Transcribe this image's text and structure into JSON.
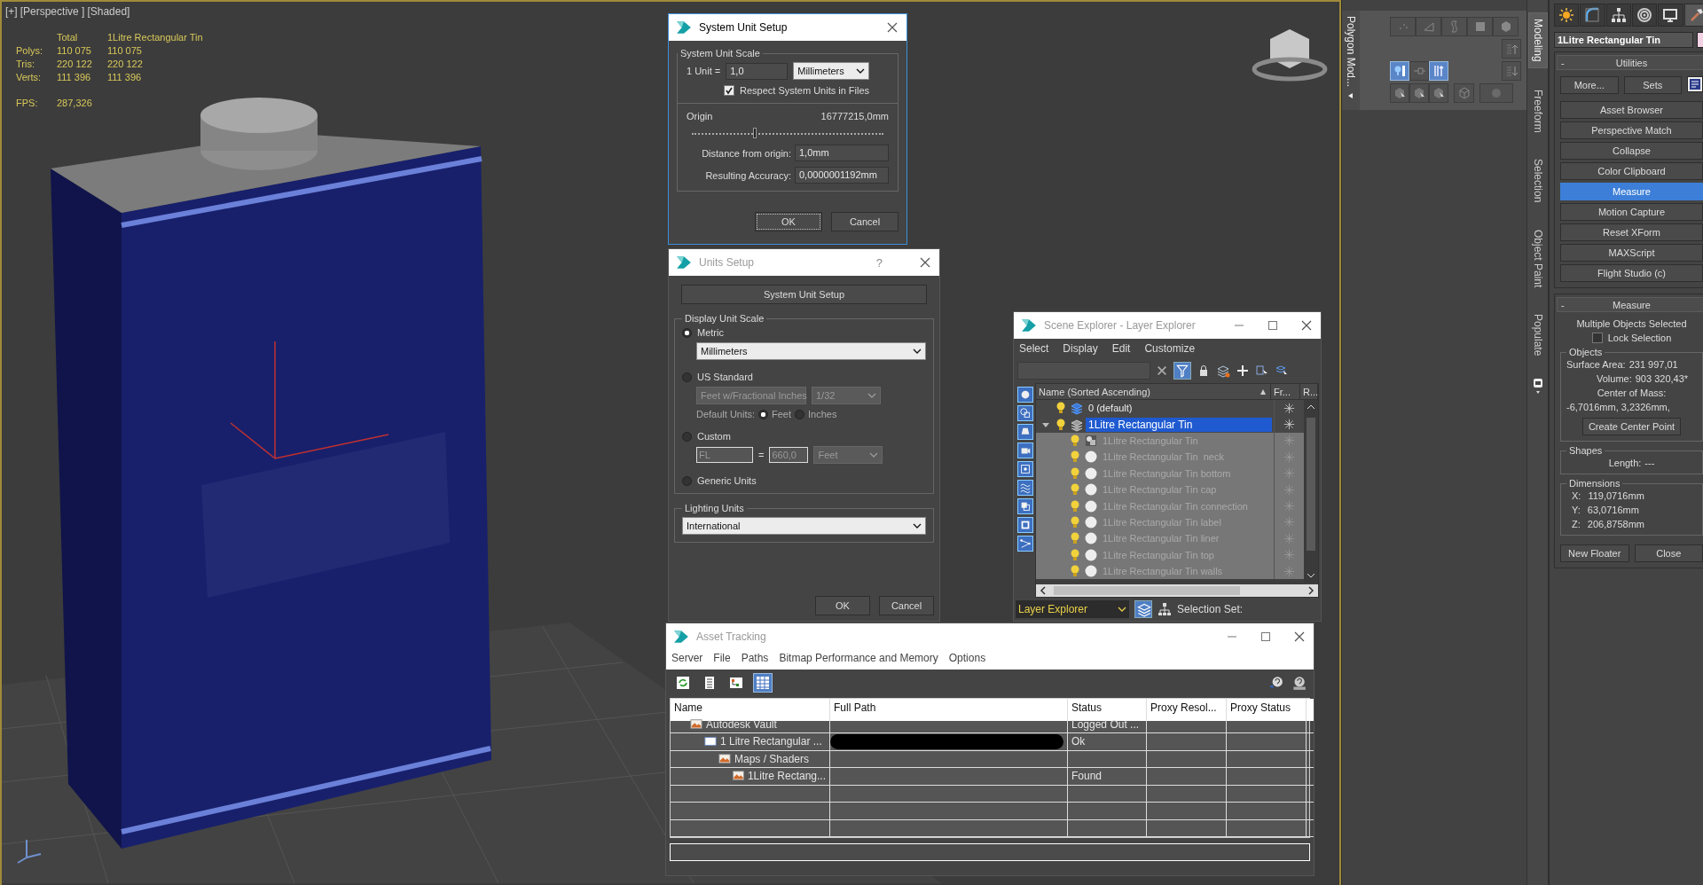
{
  "viewport": {
    "labels": [
      "[+]",
      "[Perspective ]",
      "[Shaded]"
    ],
    "stats": {
      "columns": [
        "Total",
        "1Litre Rectangular Tin"
      ],
      "rows": [
        {
          "label": "Polys:",
          "values": [
            "110 075",
            "110 075"
          ]
        },
        {
          "label": "Tris:",
          "values": [
            "220 122",
            "220 122"
          ]
        },
        {
          "label": "Verts:",
          "values": [
            "111 396",
            "111 396"
          ]
        }
      ],
      "fps_label": "FPS:",
      "fps": "287,326"
    }
  },
  "system_unit_setup": {
    "title": "System Unit Setup",
    "active": true,
    "group": "System Unit Scale",
    "unit_label": "1 Unit =",
    "unit_value": "1,0",
    "unit_dropdown": "Millimeters",
    "respect_checkbox": {
      "label": "Respect System Units in Files",
      "checked": true
    },
    "origin_label": "Origin",
    "origin_value": "16777215,0mm",
    "origin_slider": {
      "level": 0.33
    },
    "distance_label": "Distance from origin:",
    "distance_value": "1,0mm",
    "accuracy_label": "Resulting Accuracy:",
    "accuracy_value": "0,0000001192mm",
    "buttons": [
      "OK",
      "Cancel"
    ]
  },
  "units_setup": {
    "title": "Units Setup",
    "active": false,
    "help": "?",
    "system_button": "System Unit Setup",
    "display_group": "Display Unit Scale",
    "options": [
      {
        "kind": "metric",
        "label": "Metric",
        "selected": true,
        "dropdown": "Millimeters"
      },
      {
        "kind": "us",
        "label": "US Standard",
        "selected": false,
        "dropdowns": [
          "Feet w/Fractional Inches",
          "1/32"
        ],
        "default_units_label": "Default Units:",
        "default_units": [
          {
            "label": "Feet",
            "selected": true
          },
          {
            "label": "Inches",
            "selected": false
          }
        ]
      },
      {
        "kind": "custom",
        "label": "Custom",
        "selected": false,
        "name": "FL",
        "equals": "=",
        "value": "660,0",
        "unit": "Feet"
      },
      {
        "kind": "generic",
        "label": "Generic Units",
        "selected": false
      }
    ],
    "lighting_group": "Lighting Units",
    "lighting_dropdown": "International",
    "buttons": [
      "OK",
      "Cancel"
    ]
  },
  "scene_explorer": {
    "title": "Scene Explorer - Layer Explorer",
    "active": false,
    "menu": [
      "Select",
      "Display",
      "Edit",
      "Customize"
    ],
    "filters": [
      {
        "kind": "geometry",
        "on": true
      },
      {
        "kind": "shapes",
        "on": true
      },
      {
        "kind": "lights",
        "on": true
      },
      {
        "kind": "cameras",
        "on": true
      },
      {
        "kind": "helpers",
        "on": true
      },
      {
        "kind": "spacewarps",
        "on": true
      },
      {
        "kind": "groups",
        "on": true
      },
      {
        "kind": "xrefs",
        "on": true
      },
      {
        "kind": "bones",
        "on": true
      }
    ],
    "columns": [
      "Name (Sorted Ascending)",
      "Fr...",
      "R..."
    ],
    "layers": [
      {
        "name": "0 (default)",
        "selected": false,
        "current": true
      },
      {
        "name": "1Litre Rectangular Tin",
        "selected": true,
        "current": false,
        "expanded": true,
        "children": [
          {
            "name": "1Litre Rectangular Tin",
            "kind": "group",
            "selected": false
          },
          {
            "name": "1Litre Rectangular Tin  neck",
            "kind": "object",
            "selected": false
          },
          {
            "name": "1Litre Rectangular Tin bottom",
            "kind": "object",
            "selected": false
          },
          {
            "name": "1Litre Rectangular Tin cap",
            "kind": "object",
            "selected": false
          },
          {
            "name": "1Litre Rectangular Tin connection",
            "kind": "object",
            "selected": false
          },
          {
            "name": "1Litre Rectangular Tin label",
            "kind": "object",
            "selected": false
          },
          {
            "name": "1Litre Rectangular Tin liner",
            "kind": "object",
            "selected": false
          },
          {
            "name": "1Litre Rectangular Tin top",
            "kind": "object",
            "selected": false
          },
          {
            "name": "1Litre Rectangular Tin walls",
            "kind": "object",
            "selected": false
          }
        ]
      }
    ],
    "explorer_dropdown": "Layer Explorer",
    "selection_label": "Selection Set:"
  },
  "asset_tracking": {
    "title": "Asset Tracking",
    "active": false,
    "menu": [
      "Server",
      "File",
      "Paths",
      "Bitmap Performance and Memory",
      "Options"
    ],
    "toolbar": [
      {
        "kind": "refresh",
        "on": false
      },
      {
        "kind": "list",
        "on": false
      },
      {
        "kind": "tree",
        "on": false
      },
      {
        "kind": "table",
        "on": true
      }
    ],
    "columns": [
      "Name",
      "Full Path",
      "Status",
      "Proxy Resol...",
      "Proxy Status"
    ],
    "rows": [
      {
        "name": "Autodesk Vault",
        "kind": "provider",
        "status": "Logged Out ...",
        "children": [
          {
            "name": "1 Litre Rectangular ...",
            "kind": "file",
            "status": "Ok",
            "path_redacted": true,
            "children": [
              {
                "name": "Maps / Shaders",
                "kind": "provider",
                "children": [
                  {
                    "name": "1Litre Rectang...",
                    "kind": "provider",
                    "status": "Found"
                  }
                ]
              }
            ]
          }
        ]
      }
    ]
  },
  "ribbon": {
    "panel_label": "Polygon Mod...",
    "tool_rows": [
      [
        {
          "kind": "vertex",
          "on": false
        },
        {
          "kind": "edge",
          "on": false
        },
        {
          "kind": "border",
          "on": false
        },
        {
          "kind": "polygon",
          "on": false
        },
        {
          "kind": "element",
          "on": false
        }
      ],
      [
        {
          "kind": "up",
          "on": false
        }
      ],
      [
        {
          "kind": "isolate",
          "on": true
        },
        {
          "kind": "pin",
          "on": false
        },
        {
          "kind": "ignore",
          "on": true
        },
        {
          "kind": "down",
          "on": false
        }
      ],
      [
        {
          "kind": "select",
          "on": false
        },
        {
          "kind": "select",
          "on": false
        },
        {
          "kind": "select",
          "on": false
        },
        {
          "kind": "cage",
          "on": false
        },
        {
          "kind": "circle",
          "on": false
        }
      ]
    ],
    "tabs": [
      {
        "label": "Modeling",
        "selected": true
      },
      {
        "label": "Freeform",
        "selected": false
      },
      {
        "label": "Selection",
        "selected": false
      },
      {
        "label": "Object Paint",
        "selected": false
      },
      {
        "label": "Populate",
        "selected": false
      }
    ]
  },
  "command_panel": {
    "tabs": [
      {
        "kind": "create",
        "selected": false
      },
      {
        "kind": "modify",
        "selected": false
      },
      {
        "kind": "hierarchy",
        "selected": false
      },
      {
        "kind": "motion",
        "selected": false
      },
      {
        "kind": "display",
        "selected": false
      },
      {
        "kind": "utilities",
        "selected": true
      }
    ],
    "object_name": "1Litre Rectangular Tin",
    "utilities": {
      "collapse": "-",
      "title": "Utilities",
      "more": "More...",
      "sets": "Sets",
      "buttons": [
        {
          "label": "Asset Browser",
          "selected": false
        },
        {
          "label": "Perspective Match",
          "selected": false
        },
        {
          "label": "Collapse",
          "selected": false
        },
        {
          "label": "Color Clipboard",
          "selected": false
        },
        {
          "label": "Measure",
          "selected": true
        },
        {
          "label": "Motion Capture",
          "selected": false
        },
        {
          "label": "Reset XForm",
          "selected": false
        },
        {
          "label": "MAXScript",
          "selected": false
        },
        {
          "label": "Flight Studio (c)",
          "selected": false
        }
      ]
    },
    "measure": {
      "collapse": "-",
      "title": "Measure",
      "status": "Multiple Objects Selected",
      "lock": {
        "label": "Lock Selection",
        "checked": false
      },
      "objects": {
        "title": "Objects",
        "surface_area_label": "Surface Area:",
        "surface_area": "231 997,01",
        "volume_label": "Volume:",
        "volume": "903 320,43*",
        "com_label": "Center of Mass:",
        "com": "-6,7016mm, 3,2326mm,",
        "button": "Create Center Point"
      },
      "shapes": {
        "title": "Shapes",
        "length_label": "Length:",
        "length": "---"
      },
      "dimensions": {
        "title": "Dimensions",
        "rows": [
          {
            "axis": "X:",
            "value": "119,0716mm"
          },
          {
            "axis": "Y:",
            "value": "63,0716mm"
          },
          {
            "axis": "Z:",
            "value": "206,8758mm"
          }
        ]
      },
      "buttons": [
        "New Floater",
        "Close"
      ]
    }
  }
}
